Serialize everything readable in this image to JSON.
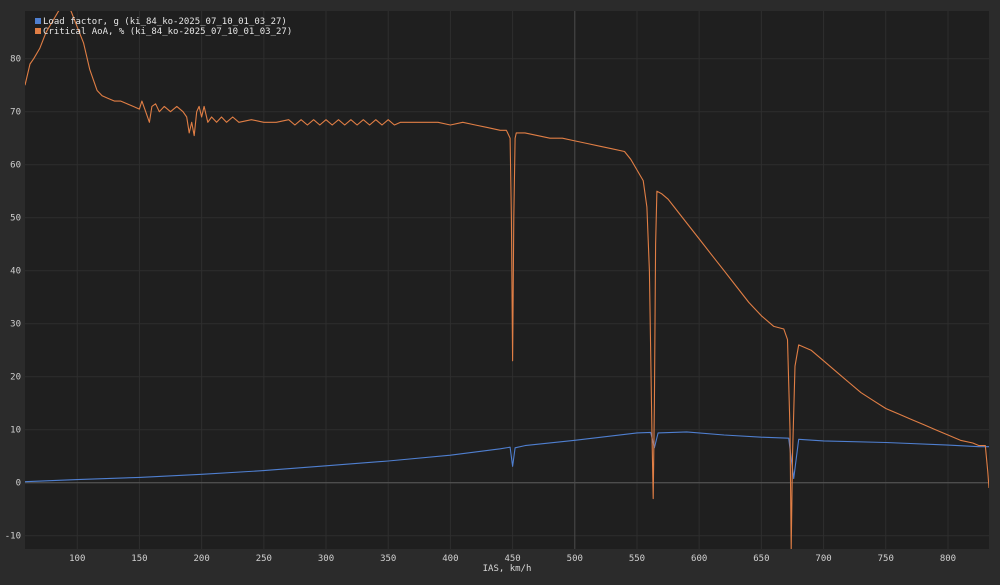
{
  "chart_data": {
    "type": "line",
    "xlabel": "IAS, km/h",
    "ylabel": "",
    "xlim": [
      58,
      833
    ],
    "ylim": [
      -12.5,
      89
    ],
    "x_ticks": [
      100,
      150,
      200,
      250,
      300,
      350,
      400,
      450,
      500,
      550,
      600,
      650,
      700,
      750,
      800
    ],
    "y_ticks": [
      -10,
      0,
      10,
      20,
      30,
      40,
      50,
      60,
      70,
      80
    ],
    "grid": true,
    "crosshair_x": 500,
    "legend_position": "top-left",
    "series": [
      {
        "name": "Load factor, g (ki_84_ko-2025_07_10_01_03_27)",
        "color": "#4f7fd0",
        "points": [
          [
            58,
            0.2
          ],
          [
            100,
            0.6
          ],
          [
            150,
            1.0
          ],
          [
            200,
            1.6
          ],
          [
            250,
            2.3
          ],
          [
            300,
            3.2
          ],
          [
            350,
            4.1
          ],
          [
            400,
            5.2
          ],
          [
            440,
            6.4
          ],
          [
            448,
            6.7
          ],
          [
            450,
            3.1
          ],
          [
            452,
            6.6
          ],
          [
            460,
            7.0
          ],
          [
            500,
            8.0
          ],
          [
            550,
            9.4
          ],
          [
            561,
            9.5
          ],
          [
            564,
            6.6
          ],
          [
            567,
            9.4
          ],
          [
            590,
            9.6
          ],
          [
            620,
            9.0
          ],
          [
            650,
            8.6
          ],
          [
            672,
            8.4
          ],
          [
            676,
            0.8
          ],
          [
            680,
            8.2
          ],
          [
            700,
            7.9
          ],
          [
            750,
            7.6
          ],
          [
            800,
            7.1
          ],
          [
            825,
            6.8
          ],
          [
            833,
            6.8
          ]
        ]
      },
      {
        "name": "Critical AoA, % (ki_84_ko-2025_07_10_01_03_27)",
        "color": "#e07e45",
        "points": [
          [
            58,
            75
          ],
          [
            60,
            77
          ],
          [
            62,
            79
          ],
          [
            65,
            80
          ],
          [
            70,
            82
          ],
          [
            75,
            85
          ],
          [
            80,
            87
          ],
          [
            85,
            89
          ],
          [
            90,
            90
          ],
          [
            95,
            89
          ],
          [
            100,
            86
          ],
          [
            105,
            83
          ],
          [
            110,
            78
          ],
          [
            113,
            76
          ],
          [
            116,
            74
          ],
          [
            120,
            73
          ],
          [
            125,
            72.5
          ],
          [
            130,
            72
          ],
          [
            135,
            72
          ],
          [
            140,
            71.5
          ],
          [
            145,
            71
          ],
          [
            150,
            70.5
          ],
          [
            152,
            72
          ],
          [
            155,
            70
          ],
          [
            158,
            68
          ],
          [
            160,
            71
          ],
          [
            163,
            71.5
          ],
          [
            166,
            70
          ],
          [
            170,
            71
          ],
          [
            175,
            70
          ],
          [
            180,
            71
          ],
          [
            185,
            70
          ],
          [
            188,
            69
          ],
          [
            190,
            66
          ],
          [
            192,
            68
          ],
          [
            194,
            65.5
          ],
          [
            196,
            70
          ],
          [
            198,
            71
          ],
          [
            200,
            69
          ],
          [
            202,
            71
          ],
          [
            205,
            68
          ],
          [
            208,
            69
          ],
          [
            212,
            68
          ],
          [
            216,
            69
          ],
          [
            220,
            68
          ],
          [
            225,
            69
          ],
          [
            230,
            68
          ],
          [
            240,
            68.5
          ],
          [
            250,
            68
          ],
          [
            260,
            68
          ],
          [
            270,
            68.5
          ],
          [
            275,
            67.5
          ],
          [
            280,
            68.5
          ],
          [
            285,
            67.5
          ],
          [
            290,
            68.5
          ],
          [
            295,
            67.5
          ],
          [
            300,
            68.5
          ],
          [
            305,
            67.5
          ],
          [
            310,
            68.5
          ],
          [
            315,
            67.5
          ],
          [
            320,
            68.5
          ],
          [
            325,
            67.5
          ],
          [
            330,
            68.5
          ],
          [
            335,
            67.5
          ],
          [
            340,
            68.5
          ],
          [
            345,
            67.5
          ],
          [
            350,
            68.5
          ],
          [
            355,
            67.5
          ],
          [
            360,
            68
          ],
          [
            370,
            68
          ],
          [
            380,
            68
          ],
          [
            390,
            68
          ],
          [
            400,
            67.5
          ],
          [
            410,
            68
          ],
          [
            420,
            67.5
          ],
          [
            430,
            67
          ],
          [
            440,
            66.5
          ],
          [
            445,
            66.5
          ],
          [
            448,
            65
          ],
          [
            449,
            50
          ],
          [
            450,
            23
          ],
          [
            451,
            50
          ],
          [
            452,
            65
          ],
          [
            453,
            66
          ],
          [
            460,
            66
          ],
          [
            470,
            65.5
          ],
          [
            480,
            65
          ],
          [
            490,
            65
          ],
          [
            500,
            64.5
          ],
          [
            510,
            64
          ],
          [
            520,
            63.5
          ],
          [
            530,
            63
          ],
          [
            540,
            62.5
          ],
          [
            545,
            61
          ],
          [
            550,
            59
          ],
          [
            555,
            57
          ],
          [
            558,
            52
          ],
          [
            560,
            40
          ],
          [
            562,
            10
          ],
          [
            563,
            -3
          ],
          [
            564,
            15
          ],
          [
            565,
            45
          ],
          [
            566,
            55
          ],
          [
            570,
            54.5
          ],
          [
            575,
            53.5
          ],
          [
            580,
            52
          ],
          [
            590,
            49
          ],
          [
            600,
            46
          ],
          [
            610,
            43
          ],
          [
            620,
            40
          ],
          [
            630,
            37
          ],
          [
            640,
            34
          ],
          [
            650,
            31.5
          ],
          [
            660,
            29.5
          ],
          [
            668,
            29
          ],
          [
            671,
            27
          ],
          [
            673,
            10
          ],
          [
            674,
            -12.5
          ],
          [
            675,
            5
          ],
          [
            677,
            22
          ],
          [
            680,
            26
          ],
          [
            690,
            25
          ],
          [
            700,
            23
          ],
          [
            710,
            21
          ],
          [
            720,
            19
          ],
          [
            730,
            17
          ],
          [
            740,
            15.5
          ],
          [
            750,
            14
          ],
          [
            760,
            13
          ],
          [
            770,
            12
          ],
          [
            780,
            11
          ],
          [
            790,
            10
          ],
          [
            800,
            9
          ],
          [
            810,
            8
          ],
          [
            820,
            7.5
          ],
          [
            825,
            7
          ],
          [
            830,
            7
          ],
          [
            832,
            2
          ],
          [
            833,
            -1
          ]
        ]
      }
    ]
  }
}
